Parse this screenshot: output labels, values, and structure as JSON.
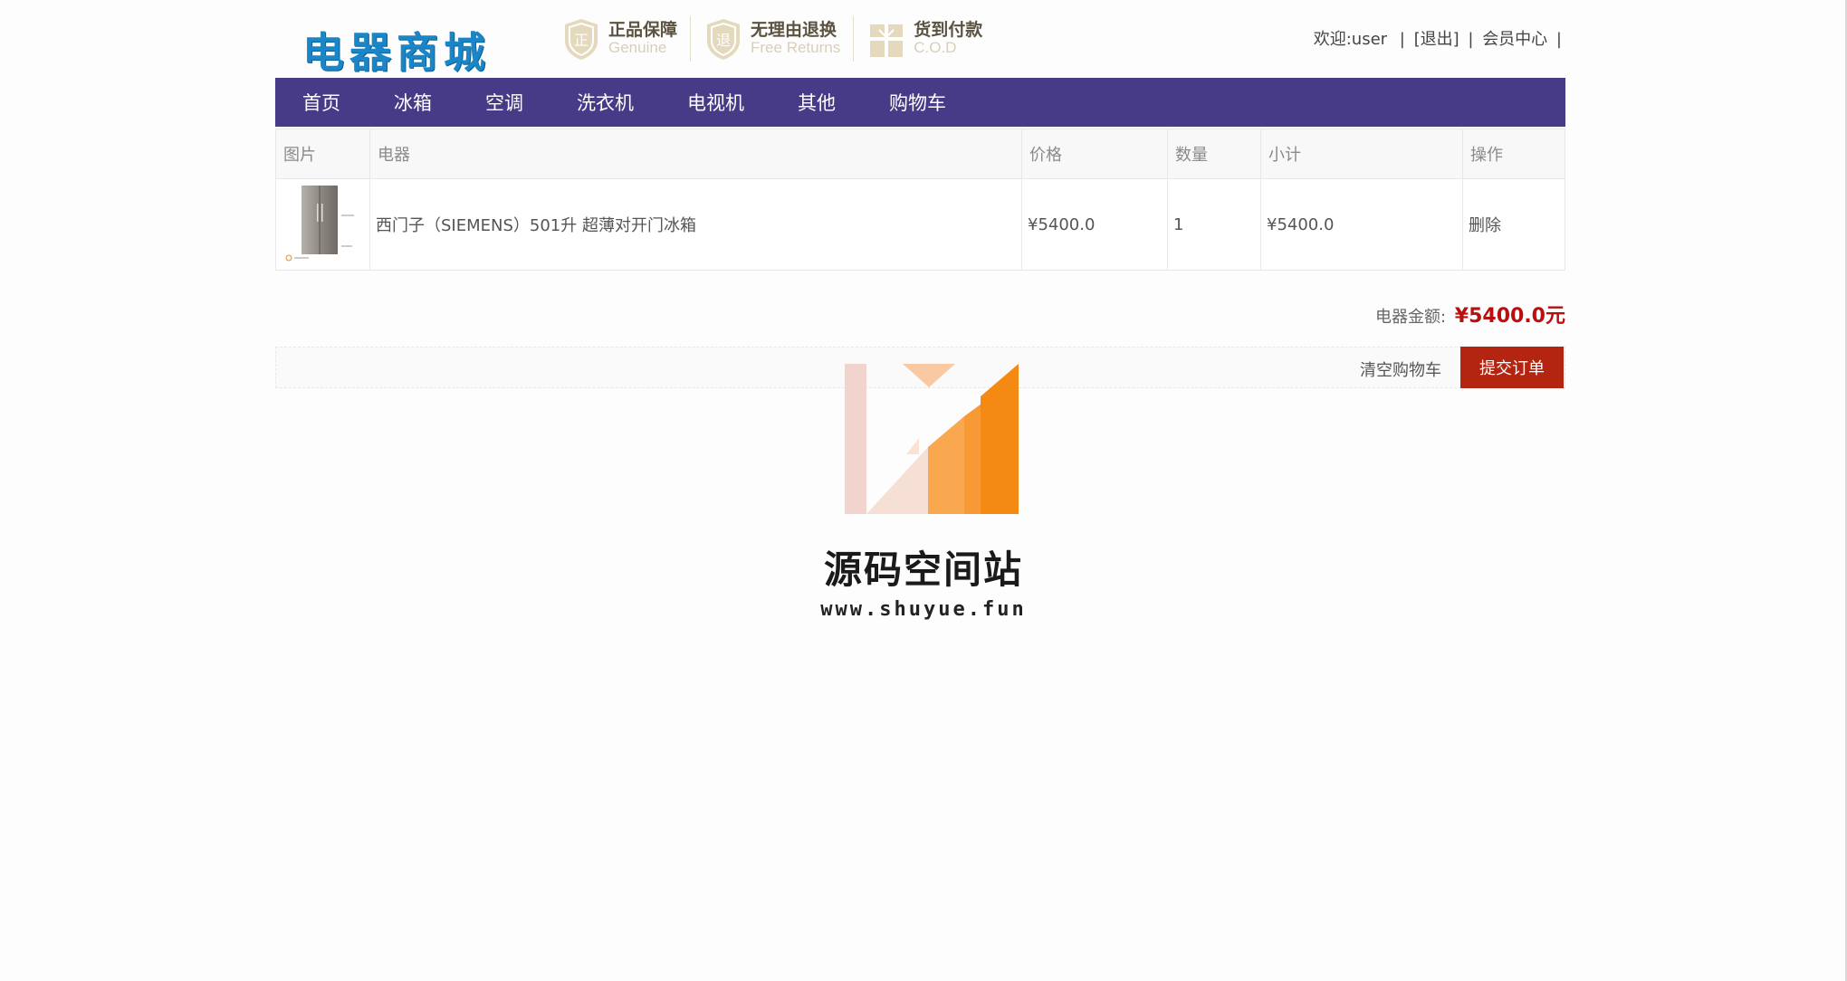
{
  "header": {
    "logo_text": "电器商城",
    "badges": [
      {
        "icon": "genuine-shield-icon",
        "title": "正品保障",
        "subtitle": "Genuine",
        "glyph": "正"
      },
      {
        "icon": "free-returns-shield-icon",
        "title": "无理由退换",
        "subtitle": "Free Returns",
        "glyph": "退"
      },
      {
        "icon": "gift-box-icon",
        "title": "货到付款",
        "subtitle": "C.O.D"
      }
    ],
    "userbar": {
      "welcome": "欢迎:user",
      "separator": "|",
      "logout": "[退出]",
      "member_center": "会员中心"
    }
  },
  "nav": {
    "items": [
      "首页",
      "冰箱",
      "空调",
      "洗衣机",
      "电视机",
      "其他",
      "购物车"
    ],
    "background": "#473b87"
  },
  "cart": {
    "columns": [
      "图片",
      "电器",
      "价格",
      "数量",
      "小计",
      "操作"
    ],
    "rows": [
      {
        "image": "refrigerator-image",
        "name": "西门子（SIEMENS）501升 超薄对开门冰箱",
        "price": "¥5400.0",
        "quantity": "1",
        "subtotal": "¥5400.0",
        "action": "删除"
      }
    ],
    "total_label": "电器金额:",
    "total_amount": "¥5400.0元",
    "clear_label": "清空购物车",
    "submit_label": "提交订单",
    "accent_color": "#b32411",
    "amount_color": "#b8100f"
  },
  "watermark": {
    "title": "源码空间站",
    "url": "www.shuyue.fun"
  }
}
